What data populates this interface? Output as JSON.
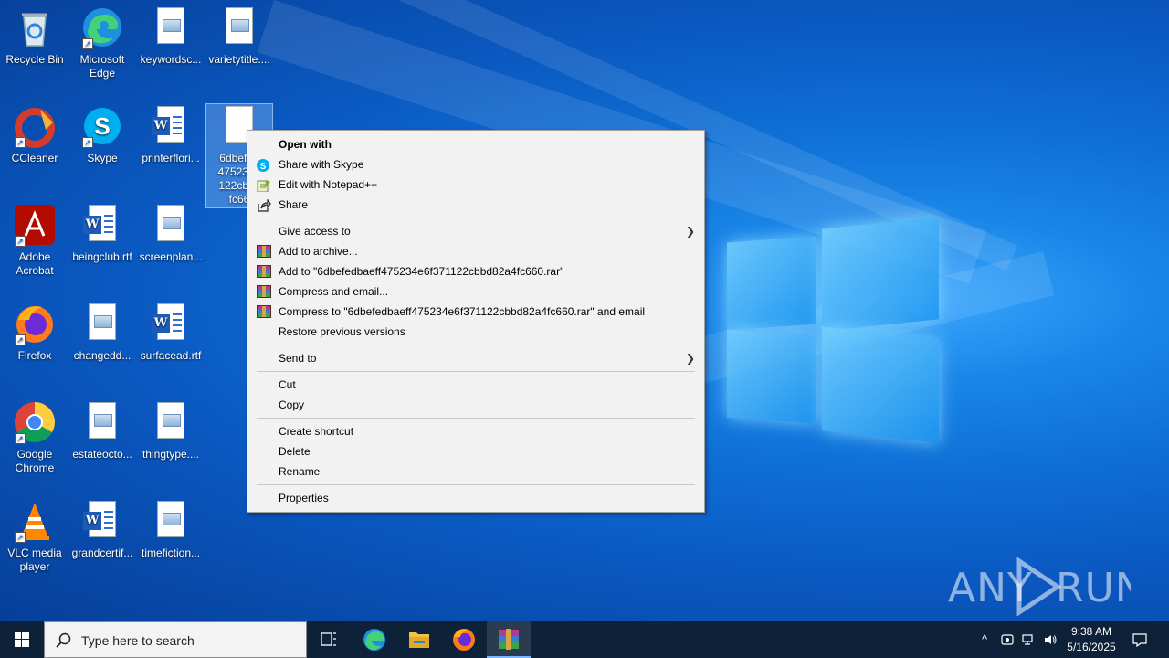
{
  "desktop": {
    "icons": [
      {
        "label": "Recycle Bin"
      },
      {
        "label": "Microsoft Edge"
      },
      {
        "label": "keywordsc..."
      },
      {
        "label": "varietytitle...."
      },
      {
        "label": "CCleaner"
      },
      {
        "label": "Skype"
      },
      {
        "label": "printerflori..."
      },
      {
        "label": "6dbefedbaeff475234e6f371122cbbd82a4fc660"
      },
      {
        "label": "Adobe Acrobat"
      },
      {
        "label": "beingclub.rtf"
      },
      {
        "label": "screenplan..."
      },
      {
        "label": "Firefox"
      },
      {
        "label": "changedd..."
      },
      {
        "label": "surfacead.rtf"
      },
      {
        "label": "Google Chrome"
      },
      {
        "label": "estateocto..."
      },
      {
        "label": "thingtype...."
      },
      {
        "label": "VLC media player"
      },
      {
        "label": "grandcertif..."
      },
      {
        "label": "timefiction..."
      }
    ],
    "selected_icon_lines": [
      "6dbefed",
      "475234e",
      "122cbbc",
      "fc66"
    ]
  },
  "context_menu": {
    "items": [
      {
        "label": "Open with",
        "icon": "none",
        "bold": true
      },
      {
        "label": "Share with Skype",
        "icon": "skype-icon"
      },
      {
        "label": "Edit with Notepad++",
        "icon": "notepad-plus-plus-icon"
      },
      {
        "label": "Share",
        "icon": "share-icon"
      },
      {
        "label": "Give access to",
        "submenu": true
      },
      {
        "label": "Add to archive...",
        "icon": "winrar-icon"
      },
      {
        "label": "Add to \"6dbefedbaeff475234e6f371122cbbd82a4fc660.rar\"",
        "icon": "winrar-icon"
      },
      {
        "label": "Compress and email...",
        "icon": "winrar-icon"
      },
      {
        "label": "Compress to \"6dbefedbaeff475234e6f371122cbbd82a4fc660.rar\" and email",
        "icon": "winrar-icon"
      },
      {
        "label": "Restore previous versions"
      },
      {
        "label": "Send to",
        "submenu": true
      },
      {
        "label": "Cut"
      },
      {
        "label": "Copy"
      },
      {
        "label": "Create shortcut"
      },
      {
        "label": "Delete"
      },
      {
        "label": "Rename"
      },
      {
        "label": "Properties"
      }
    ]
  },
  "taskbar": {
    "search_placeholder": "Type here to search",
    "clock_time": "9:38 AM",
    "clock_date": "5/16/2025"
  },
  "watermark": "ANY RUN",
  "colors": {
    "desktop_bg": "#0e6fd6",
    "taskbar_bg": "#0d2138",
    "menu_bg": "#f2f2f2"
  }
}
